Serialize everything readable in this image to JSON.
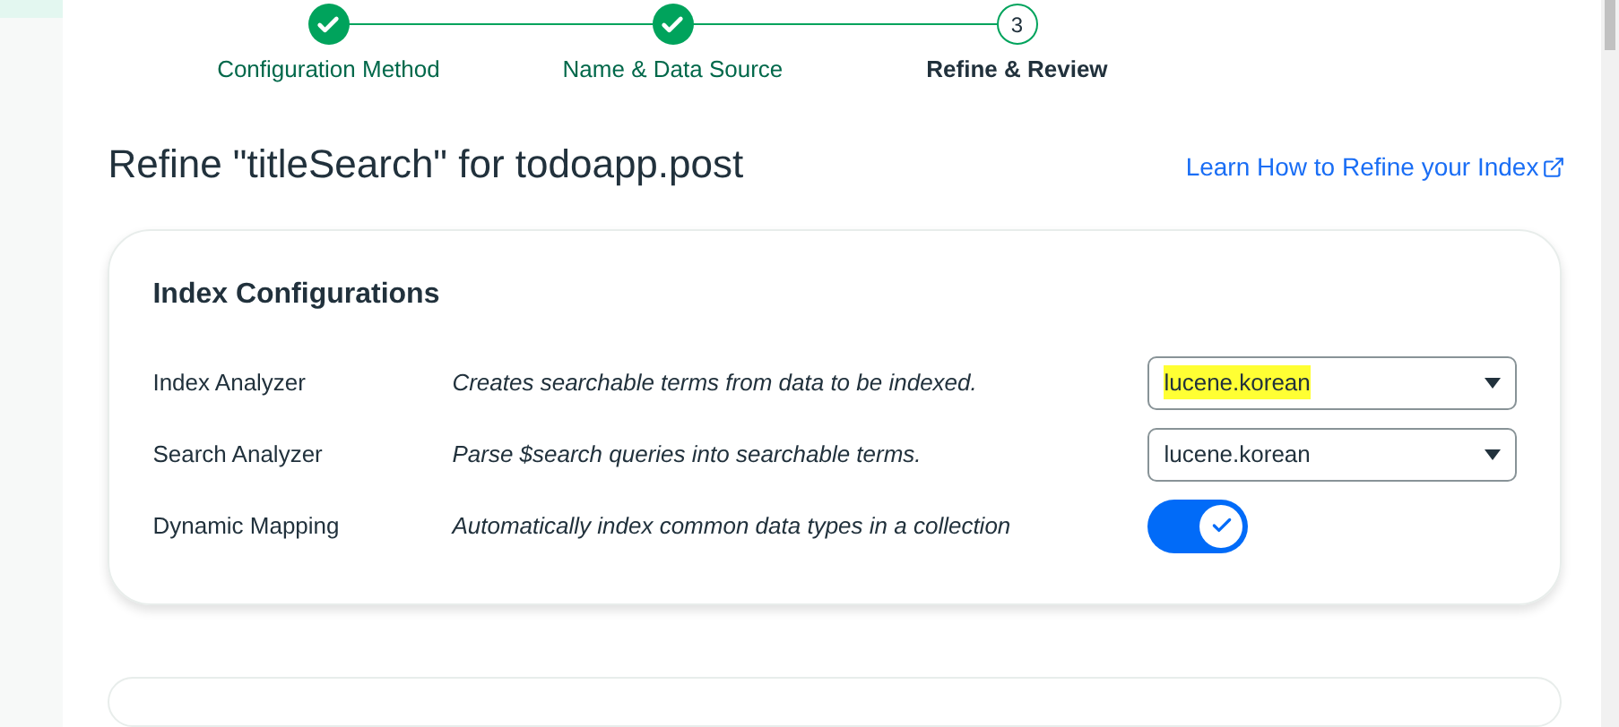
{
  "steps": [
    {
      "label": "Configuration Method",
      "complete": true
    },
    {
      "label": "Name & Data Source",
      "complete": true
    },
    {
      "label": "Refine & Review",
      "complete": false,
      "number": "3"
    }
  ],
  "title": "Refine \"titleSearch\" for todoapp.post",
  "help_link": "Learn How to Refine your Index",
  "card": {
    "heading": "Index Configurations",
    "rows": [
      {
        "kind": "select",
        "label": "Index Analyzer",
        "description": "Creates searchable terms from data to be indexed.",
        "value": "lucene.korean",
        "highlighted": true
      },
      {
        "kind": "select",
        "label": "Search Analyzer",
        "description": "Parse $search queries into searchable terms.",
        "value": "lucene.korean",
        "highlighted": false
      },
      {
        "kind": "toggle",
        "label": "Dynamic Mapping",
        "description": "Automatically index common data types in a collection",
        "on": true
      }
    ]
  }
}
